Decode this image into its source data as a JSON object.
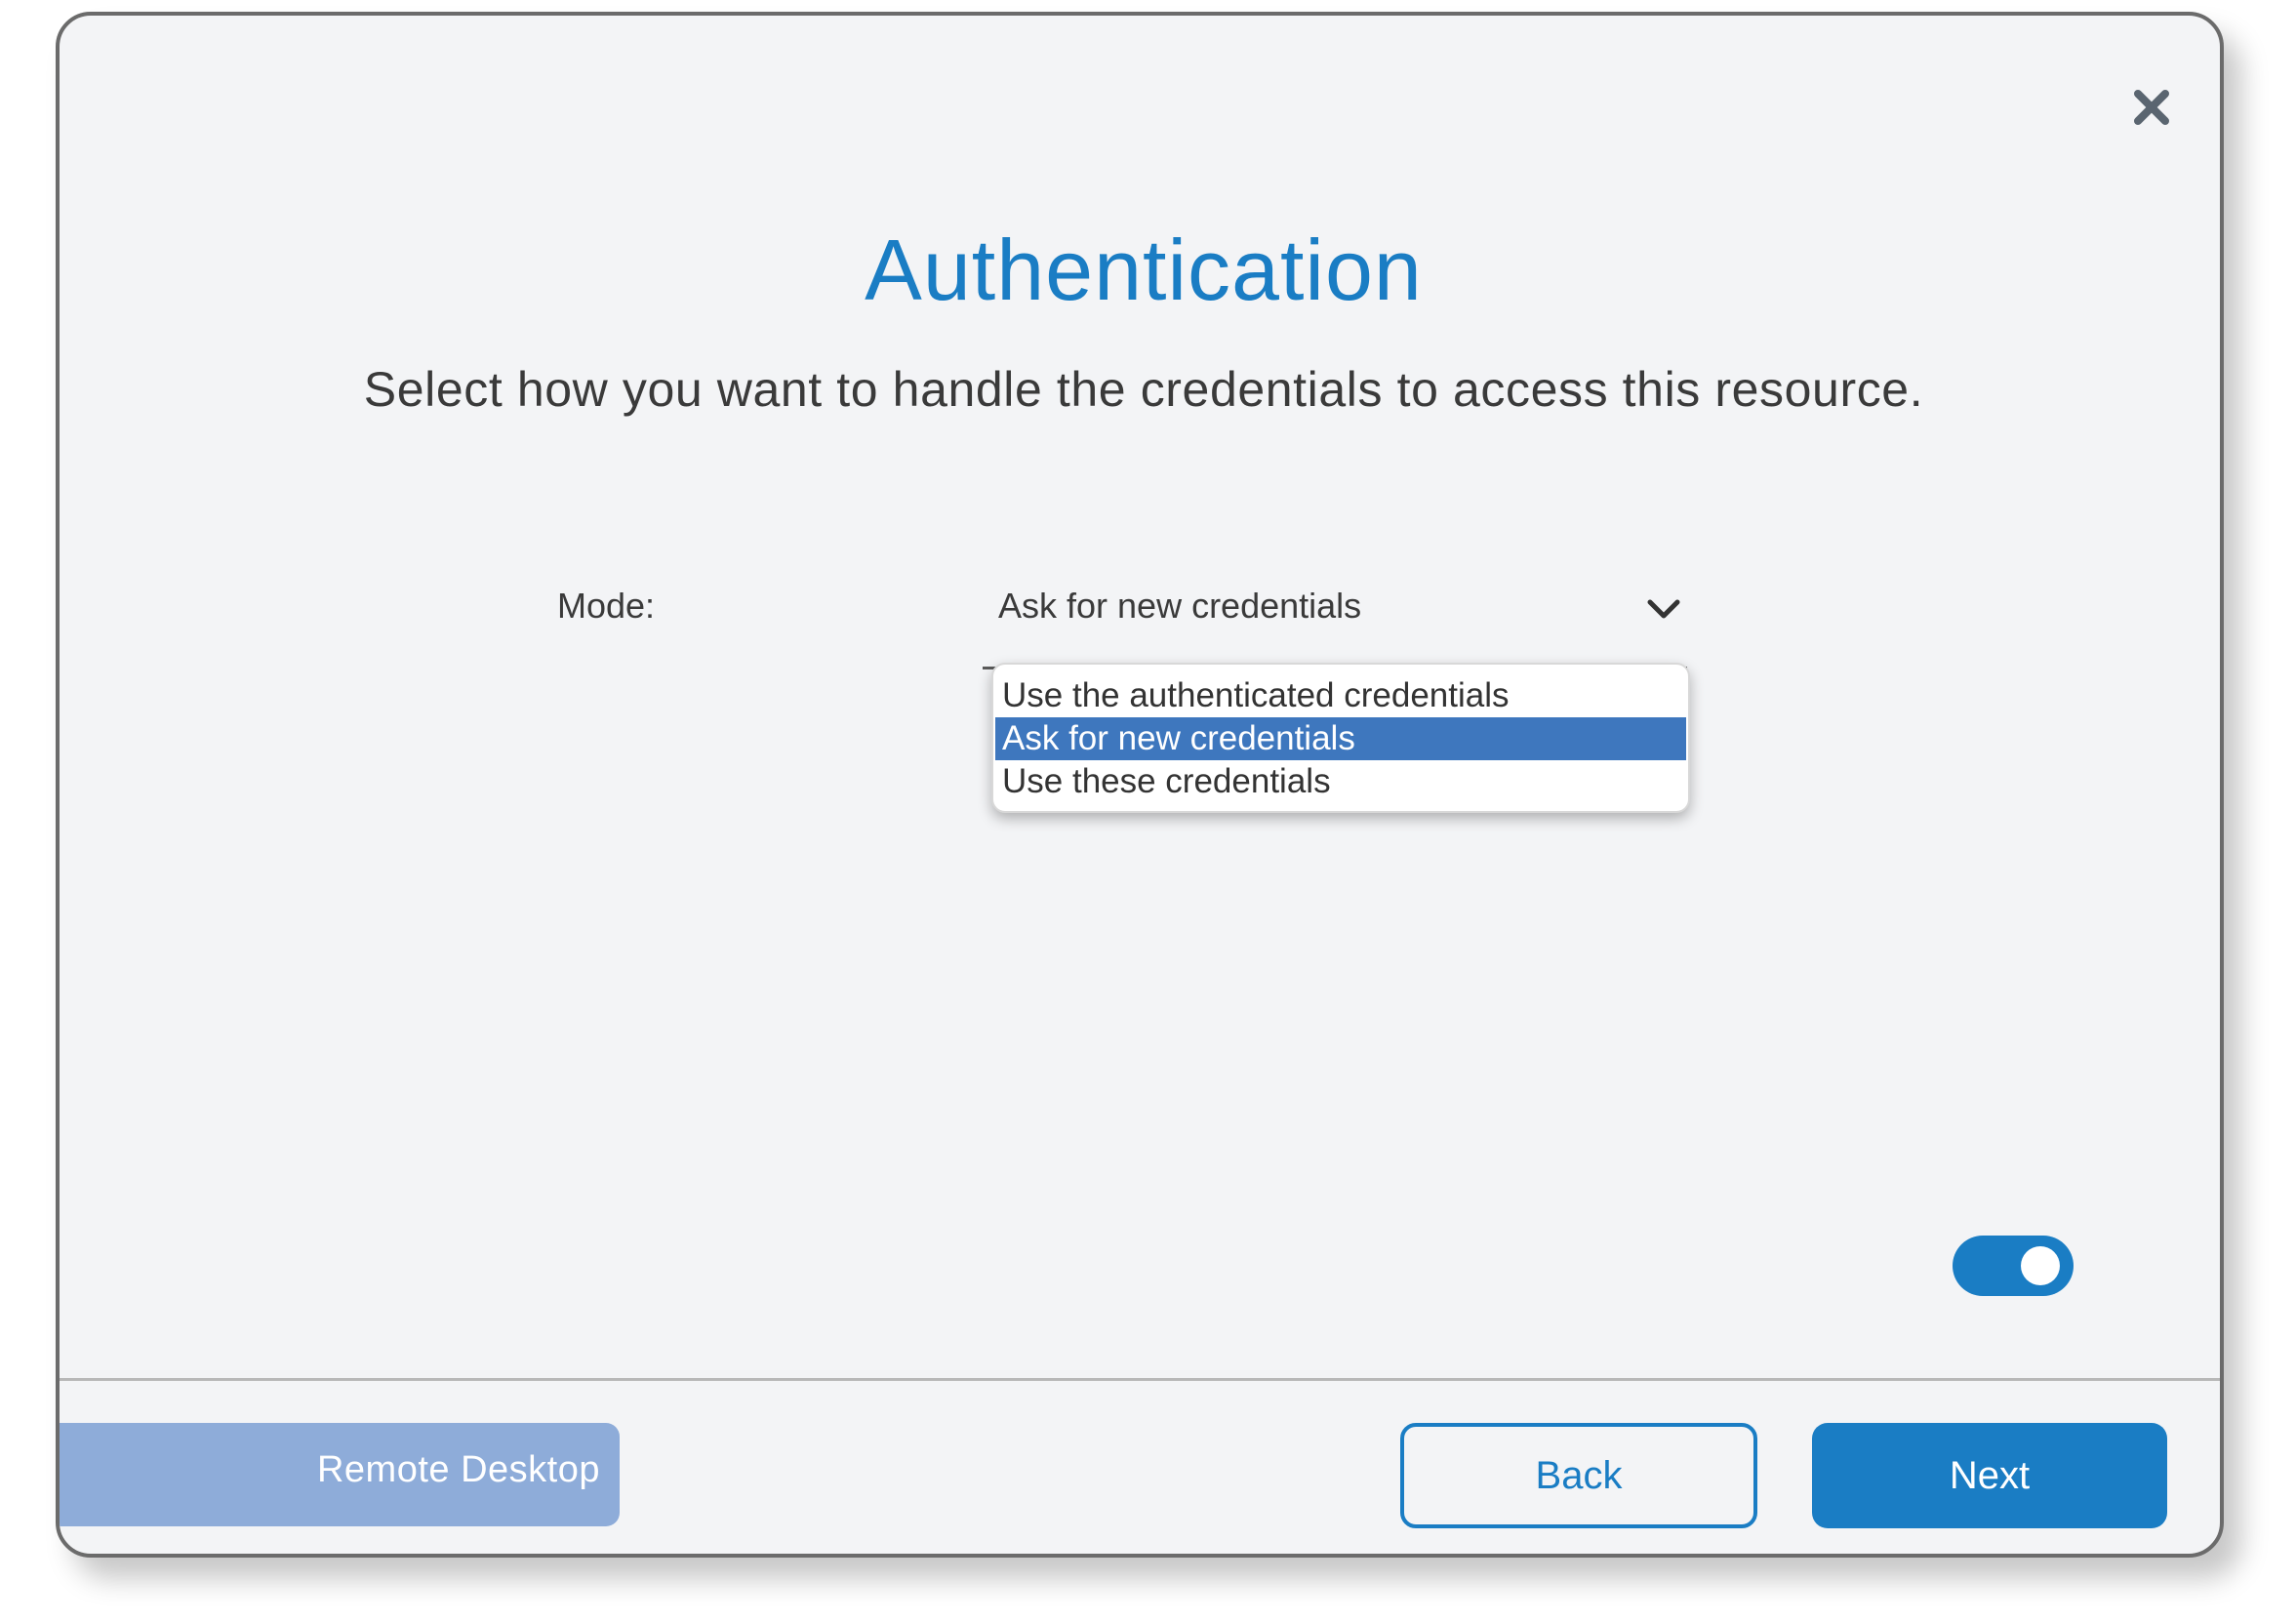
{
  "dialog": {
    "title": "Authentication",
    "subtitle": "Select how you want to handle the credentials to access this resource.",
    "close_icon": "close-icon"
  },
  "mode": {
    "label": "Mode:",
    "selected_value": "Ask for new credentials",
    "options": [
      "Use the authenticated credentials",
      "Ask for new credentials",
      "Use these credentials"
    ],
    "selected_index": 1
  },
  "toggle": {
    "state": "on"
  },
  "footer": {
    "tag_label": "Remote Desktop",
    "back_label": "Back",
    "next_label": "Next"
  },
  "colors": {
    "accent": "#1a7dc4",
    "selected_option": "#3e77be",
    "tag_background": "#8eacd9",
    "dialog_background": "#f3f4f6"
  }
}
